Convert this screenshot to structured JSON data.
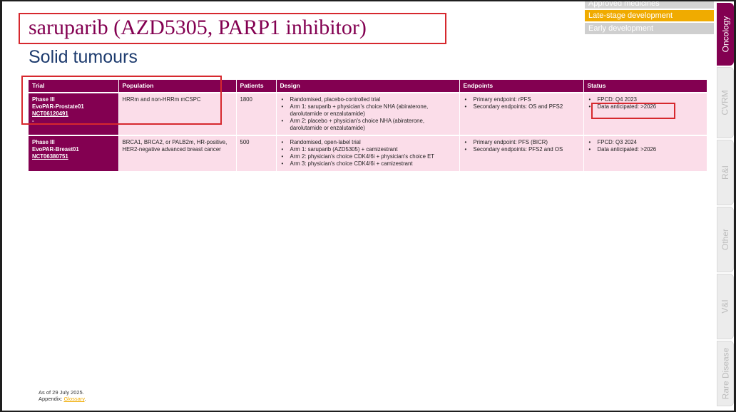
{
  "legend": {
    "approved": "Approved medicines",
    "late": "Late-stage development",
    "early": "Early development"
  },
  "tabs": [
    "Oncology",
    "CVRM",
    "R&I",
    "Other",
    "V&I",
    "Rare Disease"
  ],
  "header": {
    "title": "saruparib (AZD5305, PARP1 inhibitor)",
    "subtitle": "Solid tumours"
  },
  "table": {
    "columns": [
      "Trial",
      "Population",
      "Patients",
      "Design",
      "Endpoints",
      "Status"
    ],
    "rows": [
      {
        "phase": "Phase III",
        "name": "EvoPAR-Prostate01",
        "nct": "NCT06120491",
        "extra": "-",
        "population": "HRRm and non-HRRm mCSPC",
        "patients": "1800",
        "design": [
          "Randomised, placebo-controlled trial",
          "Arm 1: saruparib + physician's choice NHA (abiraterone, darolutamide or enzalutamide)",
          "Arm 2: placebo + physician's choice NHA (abiraterone, darolutamide or enzalutamide)"
        ],
        "endpoints": [
          "Primary endpoint: rPFS",
          "Secondary endpoints: OS and PFS2"
        ],
        "status": [
          "FPCD: Q4 2023",
          "Data anticipated: >2026"
        ]
      },
      {
        "phase": "Phase III",
        "name": "EvoPAR-Breast01",
        "nct": "NCT06380751",
        "population": "BRCA1, BRCA2, or PALB2m, HR-positive, HER2-negative advanced breast cancer",
        "patients": "500",
        "design": [
          "Randomised, open-label trial",
          "Arm 1: saruparib (AZD5305) + camizestrant",
          "Arm 2: physician's choice CDK4/6i + physician's choice ET",
          "Arm 3: physician's choice CDK4/6i + camizestrant"
        ],
        "endpoints": [
          "Primary endpoint: PFS (BICR)",
          "Secondary endpoints: PFS2 and OS"
        ],
        "status": [
          "FPCD: Q3 2024",
          "Data anticipated: >2026"
        ]
      }
    ]
  },
  "footer": {
    "date": "As of 29 July 2025.",
    "appendix_prefix": "Appendix: ",
    "glossary": "Glossary",
    "appendix_suffix": "."
  }
}
